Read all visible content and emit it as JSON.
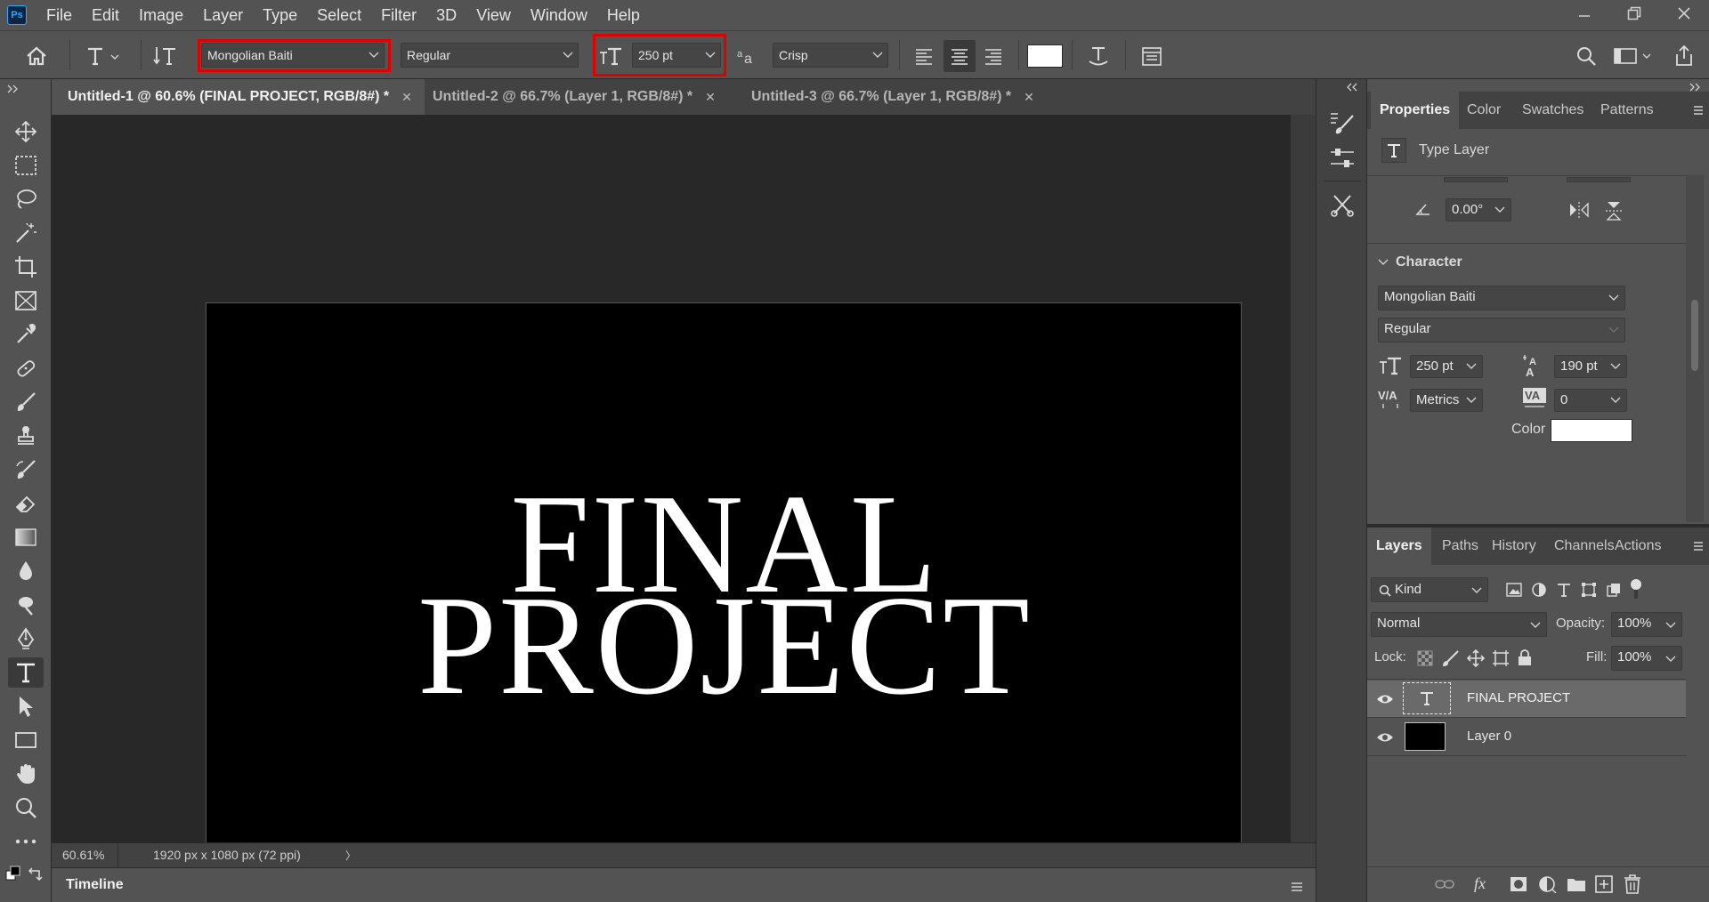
{
  "app": {
    "logo": "Ps"
  },
  "menu": [
    "File",
    "Edit",
    "Image",
    "Layer",
    "Type",
    "Select",
    "Filter",
    "3D",
    "View",
    "Window",
    "Help"
  ],
  "options": {
    "font_family": "Mongolian Baiti",
    "font_style": "Regular",
    "font_size": "250 pt",
    "antialias": "Crisp"
  },
  "tabs": [
    {
      "label": "Untitled-1 @ 60.6% (FINAL PROJECT, RGB/8#) *"
    },
    {
      "label": "Untitled-2 @ 66.7% (Layer 1, RGB/8#) *"
    },
    {
      "label": "Untitled-3 @ 66.7% (Layer 1, RGB/8#) *"
    }
  ],
  "canvas": {
    "line1": "FINAL",
    "line2": "PROJECT"
  },
  "status": {
    "zoom": "60.61%",
    "doc_info": "1920 px x 1080 px (72 ppi)",
    "arrow": "〉"
  },
  "timeline": {
    "label": "Timeline"
  },
  "properties": {
    "tabs": [
      "Properties",
      "Color",
      "Swatches",
      "Patterns"
    ],
    "layer_kind": "Type Layer",
    "angle": "0.00°",
    "character_title": "Character",
    "font_family": "Mongolian Baiti",
    "font_style": "Regular",
    "size": "250 pt",
    "leading": "190 pt",
    "kerning": "Metrics",
    "tracking": "0",
    "color_label": "Color"
  },
  "layers_panel": {
    "tabs": [
      "Layers",
      "Paths",
      "History",
      "Channels",
      "Actions"
    ],
    "filter_kind": "Kind",
    "blend_mode": "Normal",
    "opacity_label": "Opacity:",
    "opacity": "100%",
    "lock_label": "Lock:",
    "fill_label": "Fill:",
    "fill": "100%",
    "layers": [
      {
        "name": "FINAL PROJECT"
      },
      {
        "name": "Layer 0"
      }
    ]
  },
  "colors": {
    "highlight": "#e00000",
    "text_color_swatch": "#ffffff"
  }
}
